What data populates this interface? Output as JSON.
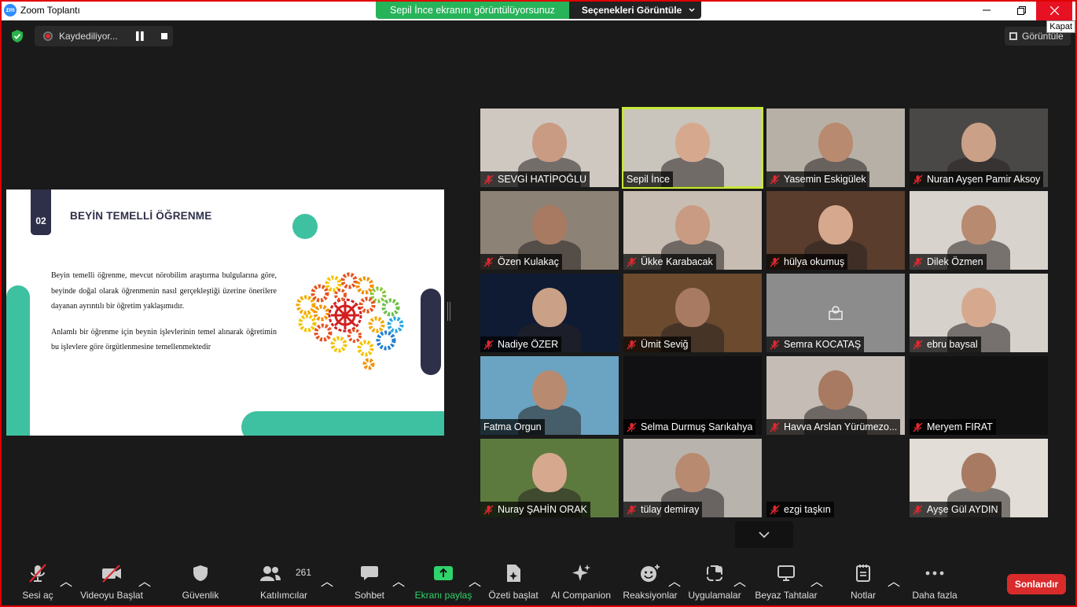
{
  "window": {
    "title": "Zoom Toplantı",
    "app_icon": "zm",
    "close_tooltip": "Kapat"
  },
  "share_banner": {
    "message": "Sepil İnce ekranını görüntülüyorsunuz",
    "options_label": "Seçenekleri Görüntüle"
  },
  "recording": {
    "label": "Kaydediliyor..."
  },
  "view": {
    "label": "Görüntüle"
  },
  "slide": {
    "number": "02",
    "heading": "BEYİN TEMELLİ ÖĞRENME",
    "paragraph1": "Beyin temelli öğrenme, mevcut nörobilim araştırma bulgularına göre, beyinde doğal olarak öğrenmenin nasıl gerçekleştiği üzerine önerilere dayanan ayrıntılı bir öğretim yaklaşımıdır.",
    "paragraph2": "Anlamlı bir öğrenme için beynin işlevlerinin temel alınarak öğretimin bu işlevlere göre örgütlenmesine temellenmektedir",
    "colors": {
      "teal": "#3ec1a0",
      "navy": "#2e2f48"
    }
  },
  "participants": [
    {
      "name": "SEVGİ HATİPOĞLU",
      "muted": true,
      "bg": "#cfc8c0"
    },
    {
      "name": "Sepil İnce",
      "muted": false,
      "bg": "#c9c4bc",
      "active": true
    },
    {
      "name": "Yasemin Eskigülek",
      "muted": true,
      "bg": "#b7b0a6"
    },
    {
      "name": "Nuran Ayşen Pamir Aksoy",
      "muted": true,
      "bg": "#4a4846"
    },
    {
      "name": "Özen Kulakaç",
      "muted": true,
      "bg": "#8d8276"
    },
    {
      "name": "Ükke Karabacak",
      "muted": true,
      "bg": "#c7bdb2"
    },
    {
      "name": "hülya okumuş",
      "muted": true,
      "bg": "#5a3d2c"
    },
    {
      "name": "Dilek Özmen",
      "muted": true,
      "bg": "#d9d3cd"
    },
    {
      "name": "Nadiye ÖZER",
      "muted": true,
      "bg": "#0f1a33"
    },
    {
      "name": "Ümit Seviğ",
      "muted": true,
      "bg": "#6b4a2e"
    },
    {
      "name": "Semra KOCATAŞ",
      "muted": true,
      "bg": "#8c8c8c",
      "no_video": true
    },
    {
      "name": "ebru baysal",
      "muted": true,
      "bg": "#d6d1cb"
    },
    {
      "name": "Fatma Orgun",
      "muted": false,
      "bg": "#6aa4c2"
    },
    {
      "name": "Selma Durmuş Sarıkahya",
      "muted": true,
      "bg": "#111013"
    },
    {
      "name": "Havva Arslan Yürümezo...",
      "muted": true,
      "bg": "#c4bcb5"
    },
    {
      "name": "Meryem FIRAT",
      "muted": true,
      "bg": "#121212"
    },
    {
      "name": "Nuray ŞAHİN ORAK",
      "muted": true,
      "bg": "#5d7a3e"
    },
    {
      "name": "tülay demiray",
      "muted": true,
      "bg": "#b8b4ad"
    },
    {
      "name": "ezgi taşkın",
      "muted": true,
      "bg": "#1a1a1a"
    },
    {
      "name": "Ayşe Gül AYDIN",
      "muted": true,
      "bg": "#e2ddd6"
    }
  ],
  "toolbar": {
    "audio": "Sesi aç",
    "video": "Videoyu Başlat",
    "security": "Güvenlik",
    "participants": "Katılımcılar",
    "participant_count": "261",
    "chat": "Sohbet",
    "share": "Ekranı paylaş",
    "summary": "Özeti başlat",
    "ai": "AI Companion",
    "reactions": "Reaksiyonlar",
    "apps": "Uygulamalar",
    "whiteboards": "Beyaz Tahtalar",
    "notes": "Notlar",
    "more": "Daha fazla",
    "end": "Sonlandır"
  }
}
